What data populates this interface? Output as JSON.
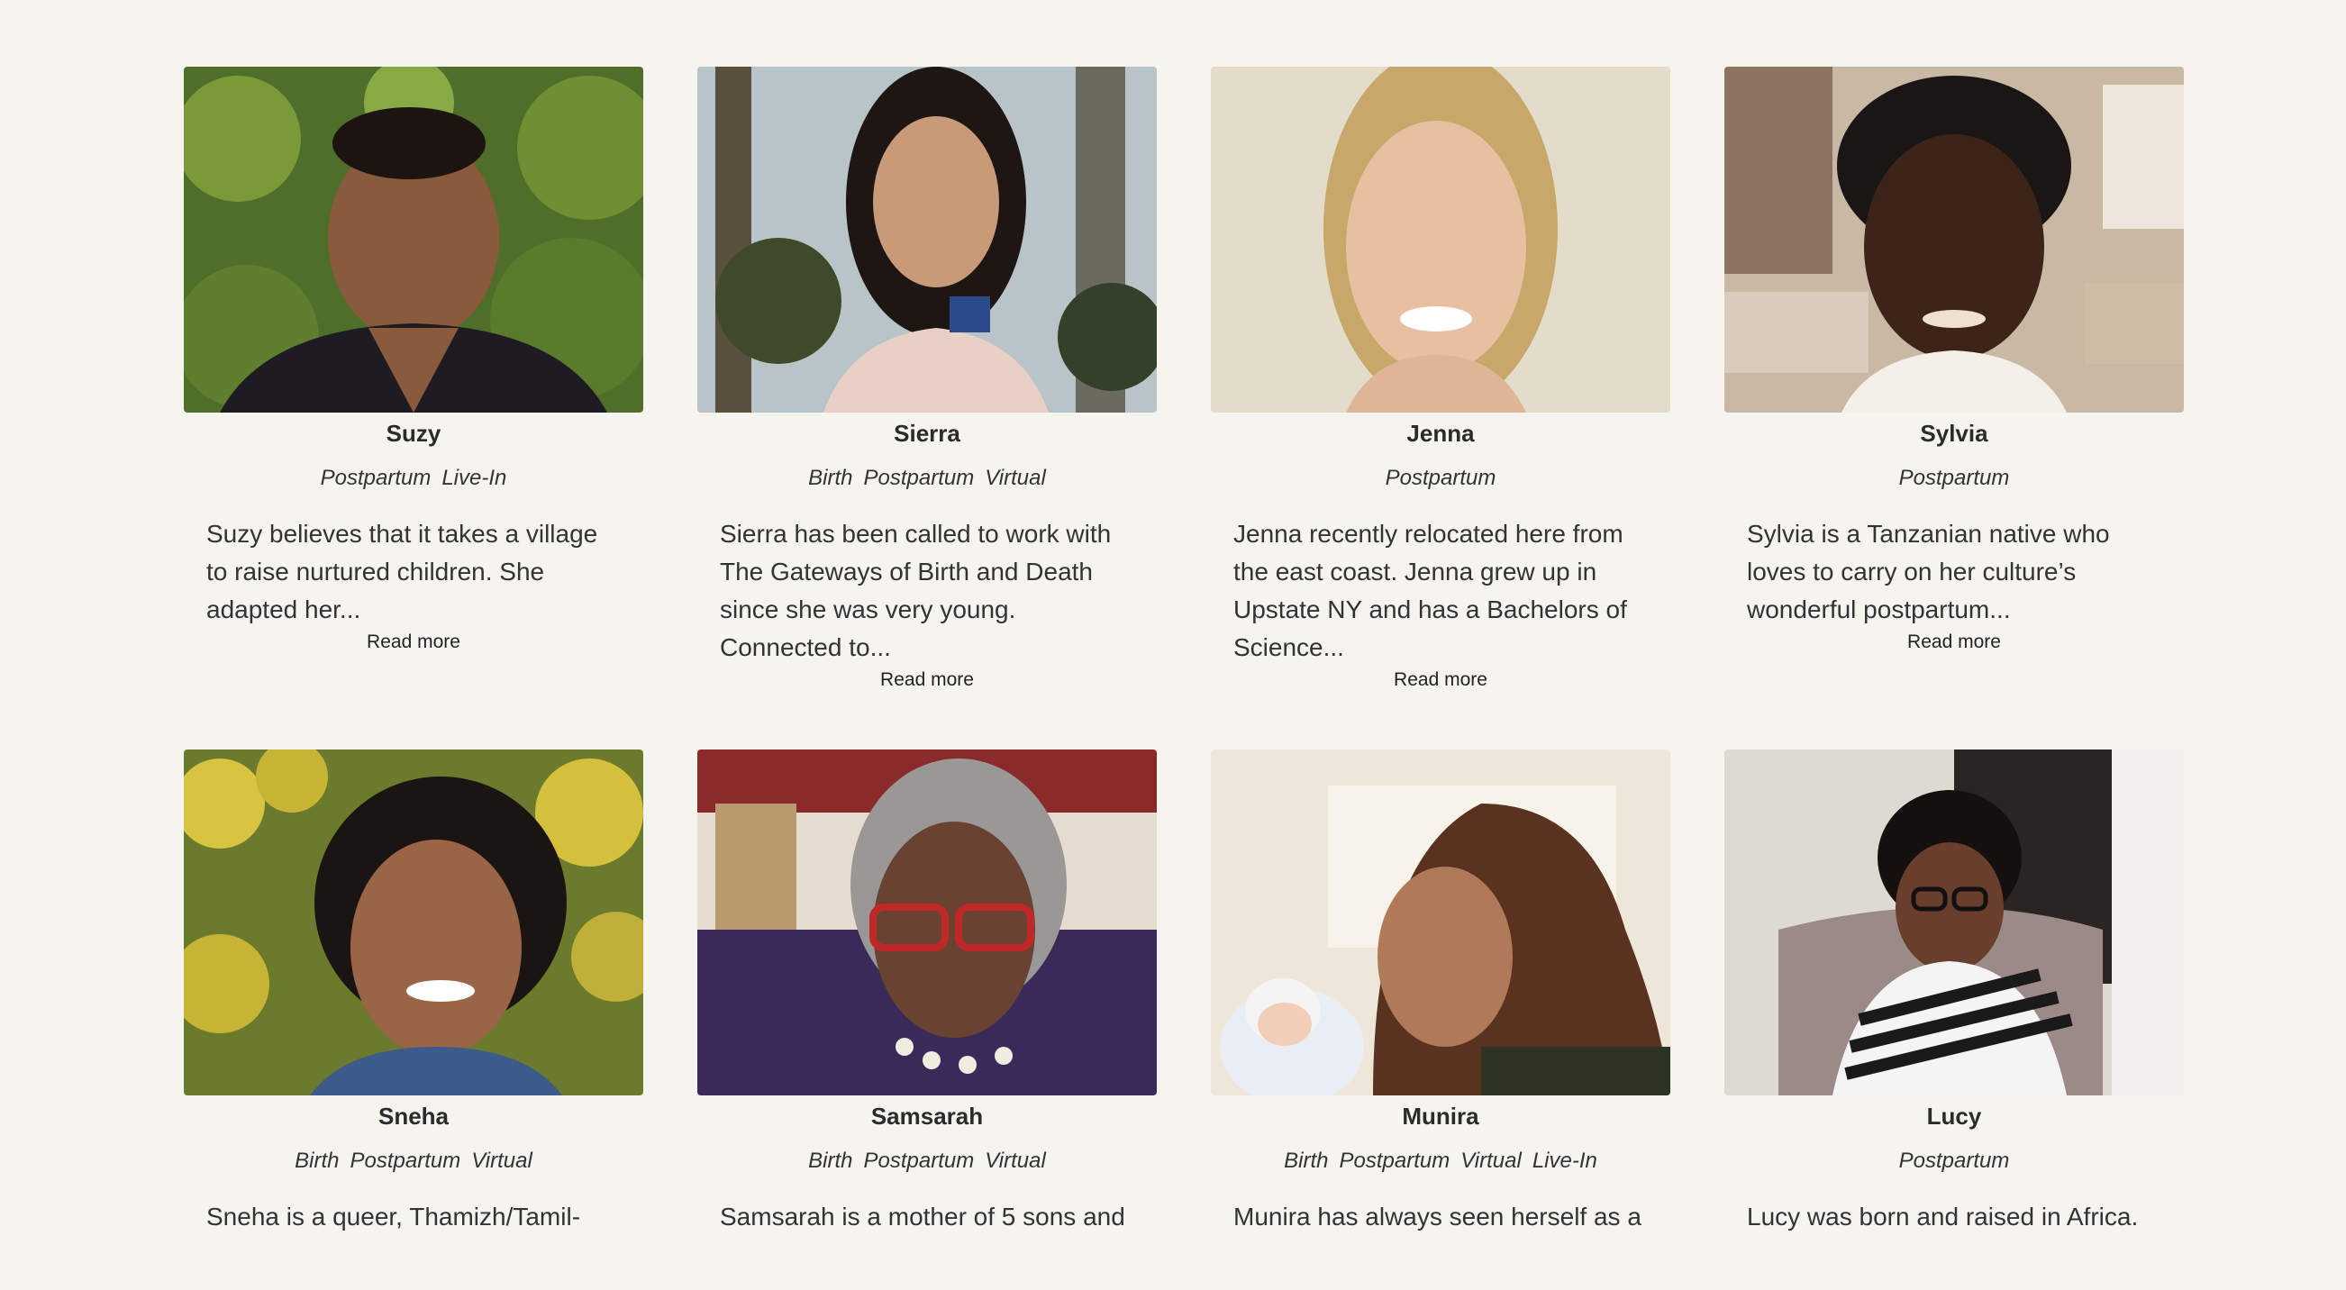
{
  "caregivers": [
    {
      "name": "Suzy",
      "tags": [
        "Postpartum",
        "Live-In"
      ],
      "bio": "Suzy believes that it takes a village to raise nurtured children. She adapted her...",
      "more": "Read more"
    },
    {
      "name": "Sierra",
      "tags": [
        "Birth",
        "Postpartum",
        "Virtual"
      ],
      "bio": "Sierra has been called to work with The Gateways of Birth and Death since she was very young. Connected to...",
      "more": "Read more"
    },
    {
      "name": "Jenna",
      "tags": [
        "Postpartum"
      ],
      "bio": "Jenna recently relocated here from the east coast. Jenna grew up in Upstate NY and has a Bachelors of Science...",
      "more": "Read more"
    },
    {
      "name": "Sylvia",
      "tags": [
        "Postpartum"
      ],
      "bio": "Sylvia is a Tanzanian native who loves to carry on her culture’s wonderful postpartum...",
      "more": "Read more"
    },
    {
      "name": "Sneha",
      "tags": [
        "Birth",
        "Postpartum",
        "Virtual"
      ],
      "bio": "Sneha is a queer, Thamizh/Tamil-"
    },
    {
      "name": "Samsarah",
      "tags": [
        "Birth",
        "Postpartum",
        "Virtual"
      ],
      "bio": "Samsarah is a mother of 5 sons and"
    },
    {
      "name": "Munira",
      "tags": [
        "Birth",
        "Postpartum",
        "Virtual",
        "Live-In"
      ],
      "bio": "Munira has always seen herself as a"
    },
    {
      "name": "Lucy",
      "tags": [
        "Postpartum"
      ],
      "bio": "Lucy was born and raised in Africa."
    }
  ]
}
